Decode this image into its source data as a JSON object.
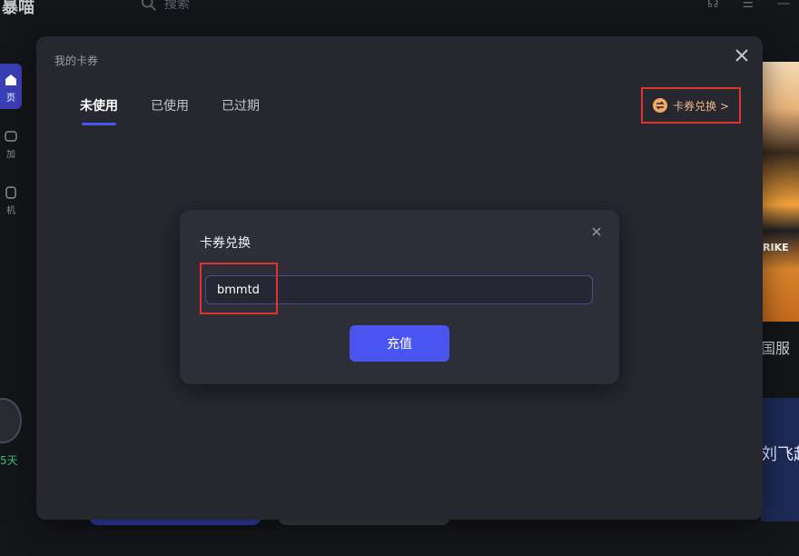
{
  "app": {
    "logo": "暴喵",
    "search_placeholder": "搜索"
  },
  "sidebar": {
    "items": [
      {
        "label": "页"
      },
      {
        "label": "加"
      },
      {
        "label": "机"
      }
    ],
    "days": "5",
    "days_unit": "天"
  },
  "background": {
    "right_label": "国服",
    "right_blue_text": "刘飞起",
    "right_art_text": "RIKE"
  },
  "modal": {
    "title": "我的卡券",
    "tabs": [
      {
        "label": "未使用"
      },
      {
        "label": "已使用"
      },
      {
        "label": "已过期"
      }
    ],
    "redeem_button": "卡券兑换 >"
  },
  "dialog": {
    "title": "卡券兑换",
    "input_value": "bmmtd",
    "submit_label": "充值"
  },
  "colors": {
    "accent": "#4a55f0",
    "highlight": "#e0332f",
    "redeem_text": "#f3b98a",
    "green": "#2fc27a"
  }
}
